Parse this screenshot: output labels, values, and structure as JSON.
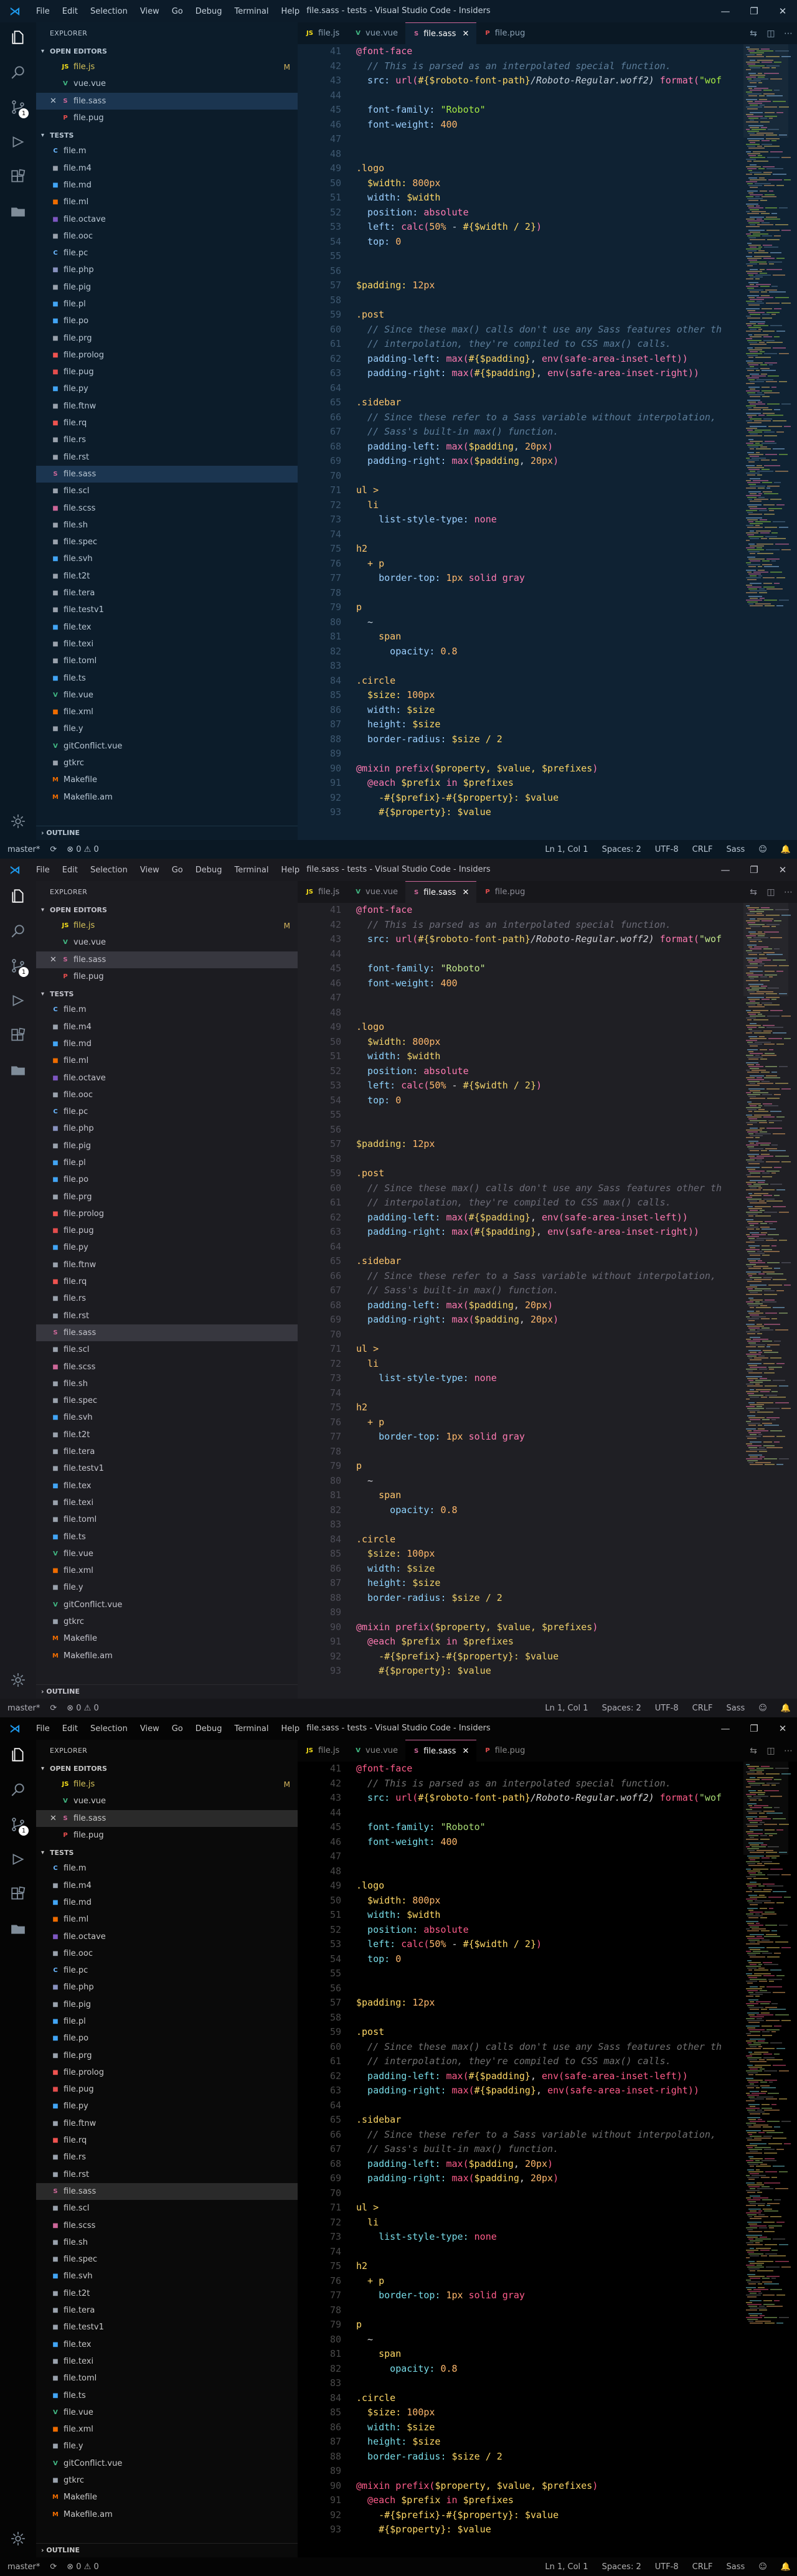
{
  "menu": [
    "File",
    "Edit",
    "Selection",
    "View",
    "Go",
    "Debug",
    "Terminal",
    "Help"
  ],
  "window_title": "file.sass - tests - Visual Studio Code - Insiders",
  "window_controls": [
    "—",
    "❐",
    "✕"
  ],
  "explorer_title": "EXPLORER",
  "open_editors_title": "OPEN EDITORS",
  "open_editors": [
    {
      "name": "file.js",
      "icon": "JS",
      "icon_color": "#f5de19",
      "modified": "M"
    },
    {
      "name": "vue.vue",
      "icon": "V",
      "icon_color": "#41b883",
      "modified": ""
    },
    {
      "name": "file.sass",
      "icon": "S",
      "icon_color": "#cd6799",
      "modified": "",
      "active": true,
      "close": "✕"
    },
    {
      "name": "file.pug",
      "icon": "P",
      "icon_color": "#e44d4d",
      "modified": ""
    }
  ],
  "tests_title": "TESTS",
  "files": [
    {
      "name": "file.m",
      "icon": "C",
      "color": "#6ab7ff"
    },
    {
      "name": "file.m4",
      "icon": "■",
      "color": "#9aa2ad"
    },
    {
      "name": "file.md",
      "icon": "■",
      "color": "#42a5f5"
    },
    {
      "name": "file.ml",
      "icon": "■",
      "color": "#ef6c00"
    },
    {
      "name": "file.octave",
      "icon": "■",
      "color": "#7e57c2"
    },
    {
      "name": "file.ooc",
      "icon": "■",
      "color": "#9aa2ad"
    },
    {
      "name": "file.pc",
      "icon": "C",
      "color": "#6ab7ff"
    },
    {
      "name": "file.php",
      "icon": "■",
      "color": "#8892bf"
    },
    {
      "name": "file.pig",
      "icon": "■",
      "color": "#9aa2ad"
    },
    {
      "name": "file.pl",
      "icon": "■",
      "color": "#42a5f5"
    },
    {
      "name": "file.po",
      "icon": "■",
      "color": "#42a5f5"
    },
    {
      "name": "file.prg",
      "icon": "■",
      "color": "#9aa2ad"
    },
    {
      "name": "file.prolog",
      "icon": "■",
      "color": "#ef5350"
    },
    {
      "name": "file.pug",
      "icon": "■",
      "color": "#e44d4d"
    },
    {
      "name": "file.py",
      "icon": "■",
      "color": "#42a5f5"
    },
    {
      "name": "file.ftnw",
      "icon": "■",
      "color": "#9aa2ad"
    },
    {
      "name": "file.rq",
      "icon": "■",
      "color": "#ef5350"
    },
    {
      "name": "file.rs",
      "icon": "■",
      "color": "#9aa2ad"
    },
    {
      "name": "file.rst",
      "icon": "■",
      "color": "#9aa2ad"
    },
    {
      "name": "file.sass",
      "icon": "S",
      "color": "#cd6799",
      "selected": true
    },
    {
      "name": "file.scl",
      "icon": "■",
      "color": "#9aa2ad"
    },
    {
      "name": "file.scss",
      "icon": "■",
      "color": "#cd6799"
    },
    {
      "name": "file.sh",
      "icon": "■",
      "color": "#9aa2ad"
    },
    {
      "name": "file.spec",
      "icon": "■",
      "color": "#9aa2ad"
    },
    {
      "name": "file.svh",
      "icon": "■",
      "color": "#42a5f5"
    },
    {
      "name": "file.t2t",
      "icon": "■",
      "color": "#9aa2ad"
    },
    {
      "name": "file.tera",
      "icon": "■",
      "color": "#9aa2ad"
    },
    {
      "name": "file.testv1",
      "icon": "■",
      "color": "#9aa2ad"
    },
    {
      "name": "file.tex",
      "icon": "■",
      "color": "#42a5f5"
    },
    {
      "name": "file.texi",
      "icon": "■",
      "color": "#9aa2ad"
    },
    {
      "name": "file.toml",
      "icon": "■",
      "color": "#9aa2ad"
    },
    {
      "name": "file.ts",
      "icon": "■",
      "color": "#42a5f5"
    },
    {
      "name": "file.vue",
      "icon": "V",
      "color": "#41b883"
    },
    {
      "name": "file.xml",
      "icon": "■",
      "color": "#ef6c00"
    },
    {
      "name": "file.y",
      "icon": "■",
      "color": "#9aa2ad"
    },
    {
      "name": "gitConflict.vue",
      "icon": "V",
      "color": "#41b883"
    },
    {
      "name": "gtkrc",
      "icon": "■",
      "color": "#9aa2ad"
    },
    {
      "name": "Makefile",
      "icon": "M",
      "color": "#ef6c00"
    },
    {
      "name": "Makefile.am",
      "icon": "M",
      "color": "#ef6c00"
    }
  ],
  "outline_title": "OUTLINE",
  "tabs": [
    {
      "label": "file.js",
      "icon": "JS",
      "color": "#f5de19"
    },
    {
      "label": "vue.vue",
      "icon": "V",
      "color": "#41b883"
    },
    {
      "label": "file.sass",
      "icon": "S",
      "color": "#cd6799",
      "active": true,
      "close": "✕"
    },
    {
      "label": "file.pug",
      "icon": "P",
      "color": "#e44d4d"
    }
  ],
  "tab_actions": [
    "⇆",
    "◫",
    "⋯"
  ],
  "status": {
    "branch": "master*",
    "sync": "⟳",
    "problems": "⊗ 0 ⚠ 0",
    "position": "Ln 1, Col 1",
    "spaces": "Spaces: 2",
    "encoding": "UTF-8",
    "eol": "CRLF",
    "language": "Sass",
    "feedback": "☺",
    "bell": "🔔"
  },
  "code": {
    "first_line": 41,
    "lines": [
      [
        [
          "@font-face",
          "at"
        ]
      ],
      [
        [
          "  // This is parsed as an interpolated special function.",
          "com"
        ]
      ],
      [
        [
          "  src: ",
          "prop"
        ],
        [
          "url(",
          "fn"
        ],
        [
          "#{$roboto-font-path}",
          "var"
        ],
        [
          "/Roboto-Regular.woff2)",
          "it"
        ],
        [
          " format(",
          "fn"
        ],
        [
          "\"wof",
          "str"
        ]
      ],
      [
        [
          "",
          " "
        ]
      ],
      [
        [
          "  font-family: ",
          "prop"
        ],
        [
          "\"Roboto\"",
          "str"
        ]
      ],
      [
        [
          "  font-weight: ",
          "prop"
        ],
        [
          "400",
          "num"
        ]
      ],
      [
        [
          "",
          " "
        ]
      ],
      [
        [
          "",
          " "
        ]
      ],
      [
        [
          ".logo",
          "sel"
        ]
      ],
      [
        [
          "  $width: ",
          "var"
        ],
        [
          "800px",
          "num"
        ]
      ],
      [
        [
          "  width: ",
          "prop"
        ],
        [
          "$width",
          "var"
        ]
      ],
      [
        [
          "  position: ",
          "prop"
        ],
        [
          "absolute",
          "val"
        ]
      ],
      [
        [
          "  left: ",
          "prop"
        ],
        [
          "calc(",
          "fn"
        ],
        [
          "50%",
          "num"
        ],
        [
          " - ",
          "op"
        ],
        [
          "#{$width / 2}",
          "var"
        ],
        [
          ")",
          "fn"
        ]
      ],
      [
        [
          "  top: ",
          "prop"
        ],
        [
          "0",
          "num"
        ]
      ],
      [
        [
          "",
          " "
        ]
      ],
      [
        [
          "",
          " "
        ]
      ],
      [
        [
          "$padding: ",
          "var"
        ],
        [
          "12px",
          "num"
        ]
      ],
      [
        [
          "",
          " "
        ]
      ],
      [
        [
          ".post",
          "sel"
        ]
      ],
      [
        [
          "  // Since these max() calls don't use any Sass features other th",
          "com"
        ]
      ],
      [
        [
          "  // interpolation, they're compiled to CSS max() calls.",
          "com"
        ]
      ],
      [
        [
          "  padding-left: ",
          "prop"
        ],
        [
          "max(",
          "fn"
        ],
        [
          "#{$padding}",
          "var"
        ],
        [
          ", ",
          "op"
        ],
        [
          "env(",
          "fn"
        ],
        [
          "safe-area-inset-left",
          "val"
        ],
        [
          "))",
          "fn"
        ]
      ],
      [
        [
          "  padding-right: ",
          "prop"
        ],
        [
          "max(",
          "fn"
        ],
        [
          "#{$padding}",
          "var"
        ],
        [
          ", ",
          "op"
        ],
        [
          "env(",
          "fn"
        ],
        [
          "safe-area-inset-right",
          "val"
        ],
        [
          "))",
          "fn"
        ]
      ],
      [
        [
          "",
          " "
        ]
      ],
      [
        [
          ".sidebar",
          "sel"
        ]
      ],
      [
        [
          "  // Since these refer to a Sass variable without interpolation,",
          "com"
        ]
      ],
      [
        [
          "  // Sass's built-in max() function.",
          "com"
        ]
      ],
      [
        [
          "  padding-left: ",
          "prop"
        ],
        [
          "max(",
          "fn"
        ],
        [
          "$padding",
          "var"
        ],
        [
          ", ",
          "op"
        ],
        [
          "20px",
          "num"
        ],
        [
          ")",
          "fn"
        ]
      ],
      [
        [
          "  padding-right: ",
          "prop"
        ],
        [
          "max(",
          "fn"
        ],
        [
          "$padding",
          "var"
        ],
        [
          ", ",
          "op"
        ],
        [
          "20px",
          "num"
        ],
        [
          ")",
          "fn"
        ]
      ],
      [
        [
          "",
          " "
        ]
      ],
      [
        [
          "ul >",
          "sel"
        ]
      ],
      [
        [
          "  li",
          "sel"
        ]
      ],
      [
        [
          "    list-style-type: ",
          "prop"
        ],
        [
          "none",
          "val"
        ]
      ],
      [
        [
          "",
          " "
        ]
      ],
      [
        [
          "h2",
          "sel"
        ]
      ],
      [
        [
          "  + p",
          "sel"
        ]
      ],
      [
        [
          "    border-top: ",
          "prop"
        ],
        [
          "1px",
          "num"
        ],
        [
          " solid gray",
          "val"
        ]
      ],
      [
        [
          "",
          " "
        ]
      ],
      [
        [
          "p",
          "sel"
        ]
      ],
      [
        [
          "  ~",
          "op"
        ]
      ],
      [
        [
          "    span",
          "sel"
        ]
      ],
      [
        [
          "      opacity: ",
          "prop"
        ],
        [
          "0.8",
          "num"
        ]
      ],
      [
        [
          "",
          " "
        ]
      ],
      [
        [
          ".circle",
          "sel"
        ]
      ],
      [
        [
          "  $size: ",
          "var"
        ],
        [
          "100px",
          "num"
        ]
      ],
      [
        [
          "  width: ",
          "prop"
        ],
        [
          "$size",
          "var"
        ]
      ],
      [
        [
          "  height: ",
          "prop"
        ],
        [
          "$size",
          "var"
        ]
      ],
      [
        [
          "  border-radius: ",
          "prop"
        ],
        [
          "$size / 2",
          "var"
        ]
      ],
      [
        [
          "",
          " "
        ]
      ],
      [
        [
          "@mixin ",
          "at"
        ],
        [
          "prefix(",
          "fn"
        ],
        [
          "$property, $value, $prefixes",
          "var"
        ],
        [
          ")",
          "fn"
        ]
      ],
      [
        [
          "  @each ",
          "at"
        ],
        [
          "$prefix ",
          "var"
        ],
        [
          "in ",
          "kw"
        ],
        [
          "$prefixes",
          "var"
        ]
      ],
      [
        [
          "    -#{$prefix}-#{$property}: ",
          "var"
        ],
        [
          "$value",
          "var"
        ]
      ],
      [
        [
          "    #{$property}: $value",
          "var"
        ]
      ]
    ]
  },
  "themes": [
    {
      "editor": "#0f2233",
      "titlebar": "#0c1b29",
      "activity": "#0a1824",
      "sidebar": "#0c1c2a",
      "tabbar": "#0a1824",
      "status": "#0a1824",
      "statusfg": "#b9c6d3",
      "sel": "#1b3550",
      "fg": "#c5d1dc",
      "sfg": "#b8c6d3",
      "menu": "#c5d1dc",
      "tabfg": "#8aa0b3",
      "tabact": "#ffffff",
      "ln": "#3e5870",
      "border": "#1c3346",
      "mod": "#d6b65e",
      "at": "#ff7ab2",
      "selector": "#ffc66d",
      "prop": "#9cd0ff",
      "val": "#ff7ab2",
      "str": "#a5e844",
      "num": "#ffb86c",
      "com": "#5d7e9b",
      "varc": "#ffd866",
      "fnc": "#ff7ab2",
      "op": "#c5d1dc",
      "kw": "#ff7ab2"
    },
    {
      "editor": "#1f1f24",
      "titlebar": "#1a1a1f",
      "activity": "#1a1a1f",
      "sidebar": "#1c1c21",
      "tabbar": "#17171b",
      "status": "#17171b",
      "statusfg": "#b0b0b8",
      "sel": "#37373f",
      "fg": "#d0d0d6",
      "sfg": "#c4c4cc",
      "menu": "#c4c4cc",
      "tabfg": "#8c8c96",
      "tabact": "#ffffff",
      "ln": "#4e4e58",
      "border": "#2b2b31",
      "mod": "#d6b65e",
      "at": "#ff7ab2",
      "selector": "#ffc66d",
      "prop": "#8fd4ff",
      "val": "#ff7ab2",
      "str": "#c3e88d",
      "num": "#ffb86c",
      "com": "#6c6c78",
      "varc": "#f2d36b",
      "fnc": "#ff7ab2",
      "op": "#d0d0d6",
      "kw": "#ff7ab2"
    },
    {
      "editor": "#000000",
      "titlebar": "#050505",
      "activity": "#050505",
      "sidebar": "#0a0a0a",
      "tabbar": "#050505",
      "status": "#050505",
      "statusfg": "#b0b0b0",
      "sel": "#2a2a2a",
      "fg": "#d6d6d6",
      "sfg": "#c8c8c8",
      "menu": "#c8c8c8",
      "tabfg": "#8a8a8a",
      "tabact": "#ffffff",
      "ln": "#4a4a4a",
      "border": "#222222",
      "mod": "#d6b65e",
      "at": "#ff5c8a",
      "selector": "#ffd866",
      "prop": "#78dce8",
      "val": "#ff5c8a",
      "str": "#a9dc76",
      "num": "#ffb86c",
      "com": "#727272",
      "varc": "#ffd866",
      "fnc": "#ff5c8a",
      "op": "#d6d6d6",
      "kw": "#ff5c8a"
    }
  ]
}
